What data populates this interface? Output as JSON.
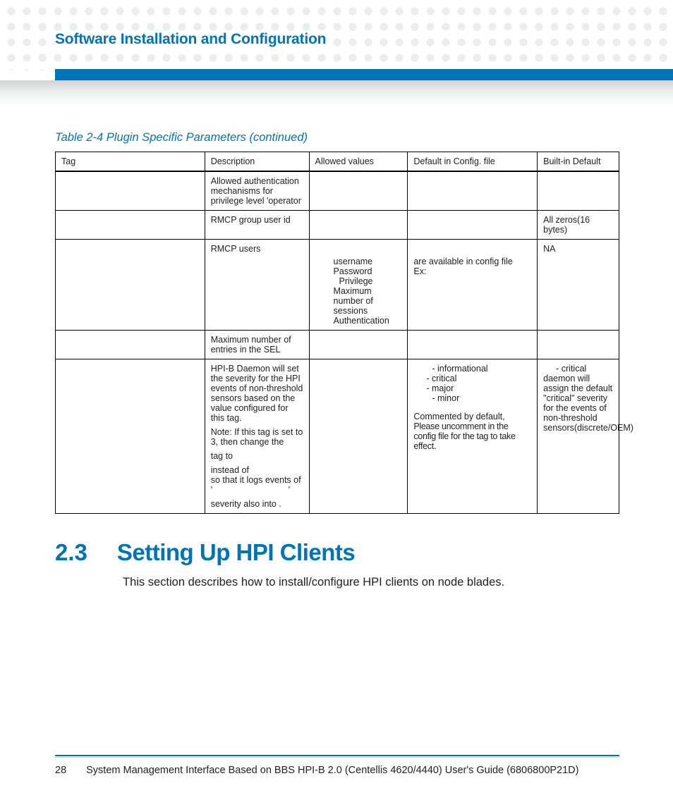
{
  "header": {
    "chapter_title": "Software Installation and Configuration"
  },
  "table": {
    "caption": "Table 2-4 Plugin Specific Parameters (continued)",
    "headers": [
      "Tag",
      "Description",
      "Allowed values",
      "Default in Config. file",
      "Built-in Default"
    ],
    "rows": [
      {
        "tag": "",
        "desc": "Allowed authentication mechanisms for privilege level 'operator",
        "allowed": "",
        "default_cfg": "",
        "builtin": ""
      },
      {
        "tag": "",
        "desc": "RMCP group user id",
        "allowed": "",
        "default_cfg": "",
        "builtin": "All zeros(16 bytes)"
      },
      {
        "tag": "",
        "desc": "RMCP users",
        "allowed_items": [
          "username",
          "Password",
          "Privilege",
          "Maximum number of sessions",
          "Authentication"
        ],
        "default_cfg_lines": [
          "are available in config file",
          "Ex:"
        ],
        "builtin": "NA"
      },
      {
        "tag": "",
        "desc": "Maximum number of entries in the SEL",
        "allowed": "",
        "default_cfg": "",
        "builtin": ""
      },
      {
        "tag": "",
        "desc_paras": [
          "HPI-B Daemon will set the severity for the HPI events of non-threshold sensors based on the value configured for this tag.",
          "Note: If this tag is set to 3, then change the",
          "tag to",
          "instead of                     so that it logs events of '                               '",
          "severity also into         ."
        ],
        "allowed": "",
        "default_cfg_levels": [
          "- informational",
          "- critical",
          "- major",
          "- minor"
        ],
        "default_cfg_tail": [
          "Commented by default,",
          "Please uncomment in the config file for the tag to take effect."
        ],
        "builtin_lead": "- critical",
        "builtin_tail": "daemon will assign the default \"critical\" severity for the events of non-threshold sensors(discrete/OEM)"
      }
    ]
  },
  "section": {
    "number": "2.3",
    "title": "Setting Up HPI Clients",
    "body": "This section describes how to install/configure HPI clients on node blades."
  },
  "footer": {
    "page": "28",
    "text": "System Management Interface Based on BBS HPI-B 2.0 (Centellis 4620/4440) User's Guide (6806800P21D)"
  }
}
